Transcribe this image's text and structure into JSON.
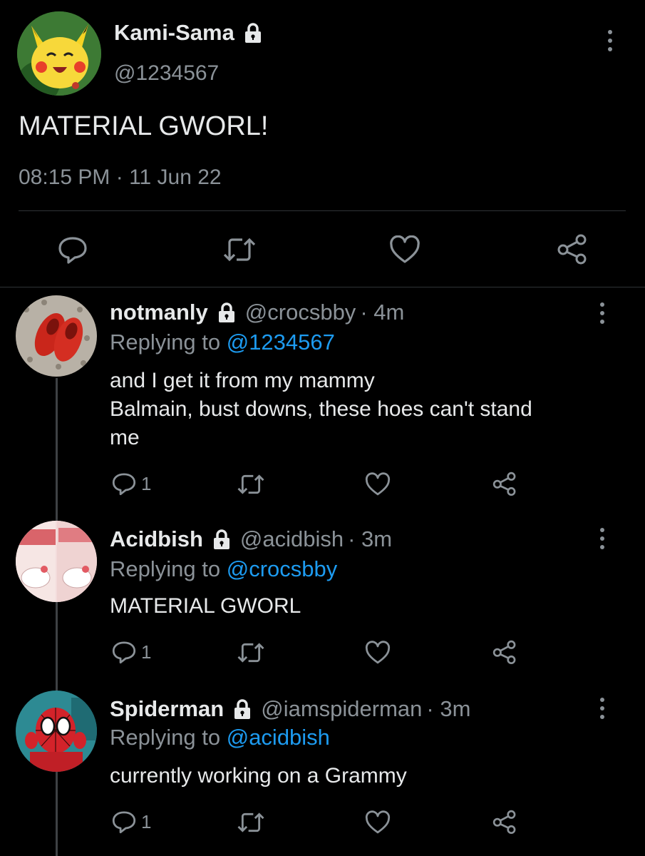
{
  "main_tweet": {
    "display_name": "Kami-Sama",
    "handle": "@1234567",
    "text": "MATERIAL GWORL!",
    "timestamp": "08:15 PM · 11 Jun 22",
    "avatar_icon": "pikachu-avatar"
  },
  "replies": [
    {
      "display_name": "notmanly",
      "handle": "@crocsbby",
      "age": "· 4m",
      "replying_label": "Replying to",
      "replying_to": "@1234567",
      "text_lines": [
        "and I get it from my mammy",
        "Balmain, bust downs, these hoes can't stand",
        "me"
      ],
      "reply_count": "1",
      "avatar_icon": "red-crocs-avatar"
    },
    {
      "display_name": "Acidbish",
      "handle": "@acidbish",
      "age": "· 3m",
      "replying_label": "Replying to",
      "replying_to": "@crocsbby",
      "text_lines": [
        "MATERIAL GWORL"
      ],
      "reply_count": "1",
      "avatar_icon": "hello-kitty-avatar"
    },
    {
      "display_name": "Spiderman",
      "handle": "@iamspiderman",
      "age": "· 3m",
      "replying_label": "Replying to",
      "replying_to": "@acidbish",
      "text_lines": [
        "currently working on a Grammy"
      ],
      "reply_count": "1",
      "avatar_icon": "spiderman-avatar"
    }
  ],
  "colors": {
    "background": "#000000",
    "text": "#e7e9ea",
    "muted": "#8b9298",
    "link": "#1d9bf0"
  }
}
